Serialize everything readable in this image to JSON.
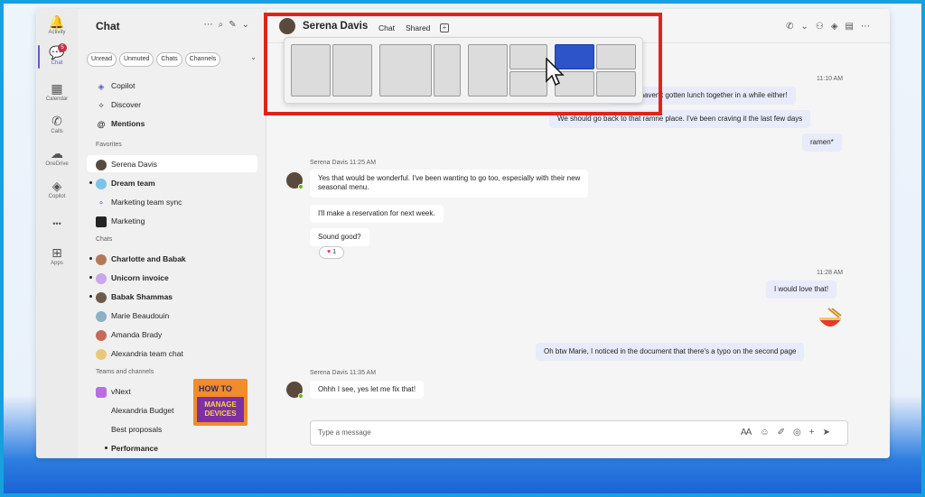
{
  "rail": {
    "items": [
      {
        "icon": "bell-icon",
        "glyph": "🔔",
        "label": "Activity"
      },
      {
        "icon": "chat-icon",
        "glyph": "💬",
        "label": "Chat",
        "badge": "5"
      },
      {
        "icon": "calendar-icon",
        "glyph": "▦",
        "label": "Calendar"
      },
      {
        "icon": "phone-icon",
        "glyph": "✆",
        "label": "Calls"
      },
      {
        "icon": "cloud-icon",
        "glyph": "☁",
        "label": "OneDrive"
      },
      {
        "icon": "copilot-icon",
        "glyph": "◈",
        "label": "Copilot"
      },
      {
        "icon": "more-icon",
        "glyph": "•••",
        "label": ""
      },
      {
        "icon": "add-apps-icon",
        "glyph": "⊞",
        "label": "Apps"
      }
    ]
  },
  "sidebar": {
    "title": "Chat",
    "filters": [
      "Unread",
      "Unmuted",
      "Chats",
      "Channels"
    ],
    "top_items": [
      {
        "label": "Copilot",
        "glyph": "◈"
      },
      {
        "label": "Discover",
        "glyph": "✧"
      },
      {
        "label": "Mentions",
        "glyph": "@"
      }
    ],
    "sections": {
      "favorites": "Favorites",
      "chats": "Chats",
      "teams": "Teams and channels"
    },
    "favorites": [
      {
        "label": "Serena Davis",
        "bold": false
      },
      {
        "label": "Dream team",
        "bold": true
      },
      {
        "label": "Marketing team sync",
        "bold": false
      },
      {
        "label": "Marketing",
        "bold": false
      }
    ],
    "chats": [
      {
        "label": "Charlotte and Babak",
        "bold": true
      },
      {
        "label": "Unicorn invoice",
        "bold": true
      },
      {
        "label": "Babak Shammas",
        "bold": true
      },
      {
        "label": "Marie Beaudouin",
        "bold": false
      },
      {
        "label": "Amanda Brady",
        "bold": false
      },
      {
        "label": "Alexandria team chat",
        "bold": false
      }
    ],
    "teams": [
      {
        "label": "vNext"
      },
      {
        "label": "Alexandria Budget"
      },
      {
        "label": "Best proposals"
      },
      {
        "label": "Performance"
      }
    ],
    "logo": {
      "line1": "HOW TO",
      "line2": "MANAGE DEVICES"
    }
  },
  "header": {
    "name": "Serena Davis",
    "tabs": [
      "Chat",
      "Shared"
    ],
    "add_tab": "+"
  },
  "messages": {
    "ts_out_1": "11:10 AM",
    "out_1": "Oh, we haven't gotten lunch together in a while either!",
    "out_2": "We should go back to that ramne place. I've been craving it the last few days",
    "out_3": "ramen*",
    "in_meta_1": "Serena Davis  11:25 AM",
    "in_1": "Yes that would be wonderful. I've been wanting to go too, especially with their new",
    "in_1b": "seasonal menu.",
    "in_2": "I'll make a reservation for next week.",
    "in_3": "Sound good?",
    "reaction": "1",
    "ts_out_2": "11:28 AM",
    "out_4": "I would love that!",
    "out_5": "Oh btw Marie, I noticed in the document that there's a typo on the second page",
    "in_meta_2": "Serena Davis  11:35 AM",
    "in_4": "Ohhh I see, yes let me fix that!"
  },
  "compose": {
    "placeholder": "Type a message"
  },
  "layout_popup": {
    "selected_group": 4,
    "selected_tile": "top-left"
  }
}
